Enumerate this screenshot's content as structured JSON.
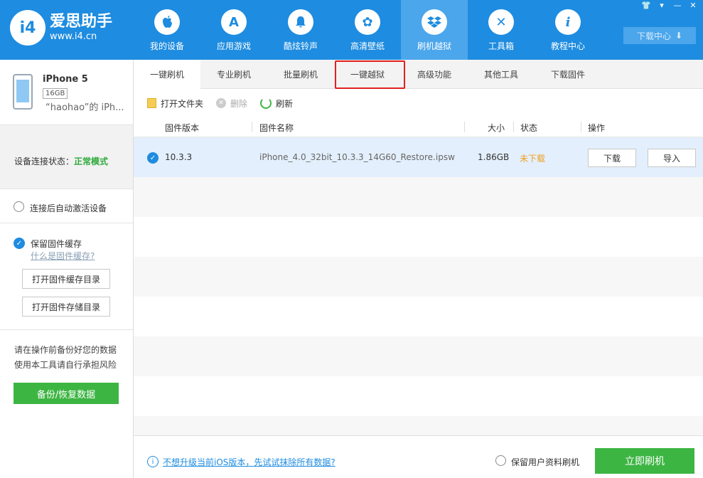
{
  "header": {
    "logo_badge": "i4",
    "logo_name": "爱思助手",
    "logo_url": "www.i4.cn",
    "nav": [
      {
        "label": "我的设备",
        "icon": "apple-icon",
        "glyph": ""
      },
      {
        "label": "应用游戏",
        "icon": "app-store-icon",
        "glyph": "A"
      },
      {
        "label": "酷炫铃声",
        "icon": "bell-icon",
        "glyph": "♪"
      },
      {
        "label": "高清壁纸",
        "icon": "flower-icon",
        "glyph": "✿"
      },
      {
        "label": "刷机越狱",
        "icon": "dropbox-icon",
        "glyph": "◈"
      },
      {
        "label": "工具箱",
        "icon": "tools-icon",
        "glyph": "✕"
      },
      {
        "label": "教程中心",
        "icon": "info-icon",
        "glyph": "i"
      }
    ],
    "download_center": "下载中心",
    "window_controls": [
      "👕",
      "▾",
      "—",
      "✕"
    ]
  },
  "sidebar": {
    "device_name": "iPhone 5",
    "device_capacity": "16GB",
    "device_owner": "“haohao”的 iPh...",
    "conn_label": "设备连接状态：",
    "conn_value": "正常模式",
    "auto_activate": "连接后自动激活设备",
    "keep_cache": "保留固件缓存",
    "what_is_cache": "什么是固件缓存?",
    "open_cache_dir": "打开固件缓存目录",
    "open_store_dir": "打开固件存储目录",
    "warn_line1": "请在操作前备份好您的数据",
    "warn_line2": "使用本工具请自行承担风险",
    "backup_button": "备份/恢复数据"
  },
  "tabs": [
    "一键刷机",
    "专业刷机",
    "批量刷机",
    "一键越狱",
    "高级功能",
    "其他工具",
    "下载固件"
  ],
  "toolbar": {
    "open_folder": "打开文件夹",
    "delete": "删除",
    "refresh": "刷新"
  },
  "table": {
    "headers": {
      "version": "固件版本",
      "name": "固件名称",
      "size": "大小",
      "status": "状态",
      "action": "操作"
    },
    "rows": [
      {
        "version": "10.3.3",
        "name": "iPhone_4.0_32bit_10.3.3_14G60_Restore.ipsw",
        "size": "1.86GB",
        "status": "未下载",
        "download": "下载",
        "import": "导入"
      }
    ]
  },
  "footer": {
    "link": "不想升级当前iOS版本，先试试抹除所有数据?",
    "keep_data": "保留用户资料刷机",
    "flash_button": "立即刷机"
  },
  "colors": {
    "brand_blue": "#1e8ce0",
    "green": "#3db543",
    "status_orange": "#f0a020",
    "highlight_red": "#e02020"
  }
}
